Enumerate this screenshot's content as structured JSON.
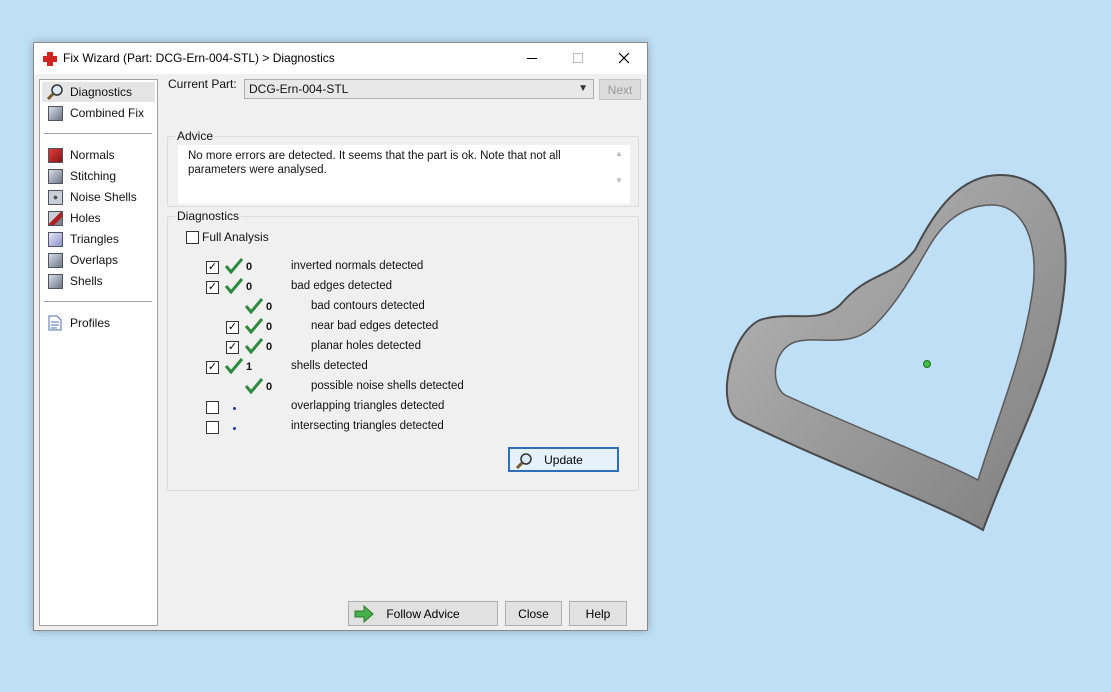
{
  "window": {
    "title": "Fix Wizard (Part: DCG-Ern-004-STL) > Diagnostics"
  },
  "nav": {
    "items": [
      {
        "label": "Diagnostics",
        "icon": "magnifier-icon"
      },
      {
        "label": "Combined Fix",
        "icon": "cube-icon"
      },
      {
        "label": "Normals",
        "icon": "normals-icon"
      },
      {
        "label": "Stitching",
        "icon": "stitching-icon"
      },
      {
        "label": "Noise Shells",
        "icon": "noise-shells-icon"
      },
      {
        "label": "Holes",
        "icon": "holes-icon"
      },
      {
        "label": "Triangles",
        "icon": "triangles-icon"
      },
      {
        "label": "Overlaps",
        "icon": "overlaps-icon"
      },
      {
        "label": "Shells",
        "icon": "shells-icon"
      },
      {
        "label": "Profiles",
        "icon": "profiles-icon"
      }
    ]
  },
  "current_part": {
    "label": "Current Part:",
    "value": "DCG-Ern-004-STL",
    "next_label": "Next"
  },
  "advice": {
    "title": "Advice",
    "text": "No more errors are detected. It seems that the part is ok. Note that not all parameters were analysed."
  },
  "diagnostics": {
    "title": "Diagnostics",
    "full_analysis_label": "Full Analysis",
    "rows": [
      {
        "checked": true,
        "count": "0",
        "label": "inverted normals detected"
      },
      {
        "checked": true,
        "count": "0",
        "label": "bad edges detected"
      },
      {
        "checked": null,
        "count": "0",
        "label": "bad contours detected"
      },
      {
        "checked": true,
        "count": "0",
        "label": "near bad edges detected"
      },
      {
        "checked": true,
        "count": "0",
        "label": "planar holes detected"
      },
      {
        "checked": true,
        "count": "1",
        "label": "shells detected"
      },
      {
        "checked": null,
        "count": "0",
        "label": "possible noise shells detected"
      },
      {
        "checked": false,
        "count": "",
        "label": "overlapping triangles detected"
      },
      {
        "checked": false,
        "count": "",
        "label": "intersecting triangles detected"
      }
    ],
    "update_label": "Update"
  },
  "footer": {
    "follow_advice_label": "Follow Advice",
    "close_label": "Close",
    "help_label": "Help"
  },
  "colors": {
    "desktop_bg": "#bfdff7",
    "tick_green": "#2e8b3e",
    "selection_bg": "#e5e5e5"
  }
}
